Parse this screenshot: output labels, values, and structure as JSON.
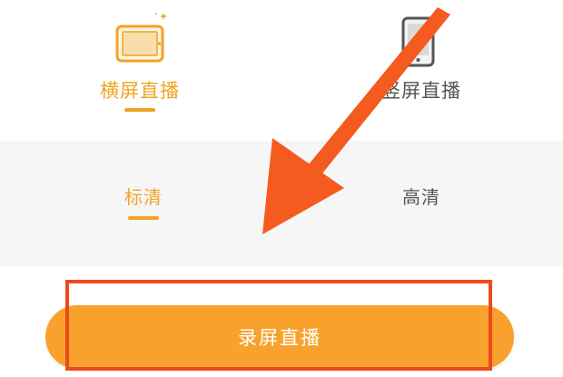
{
  "live_mode": {
    "landscape": {
      "label": "横屏直播",
      "icon": "landscape-phone-icon",
      "selected": true
    },
    "portrait": {
      "label": "竖屏直播",
      "icon": "portrait-phone-icon",
      "selected": false
    }
  },
  "quality": {
    "sd": {
      "label": "标清",
      "selected": true
    },
    "hd": {
      "label": "高清",
      "selected": false
    }
  },
  "start_button": {
    "label": "录屏直播"
  },
  "colors": {
    "accent": "#f0a426",
    "button": "#f8a12c",
    "unselected_text": "#555555",
    "annotation": "#ee4a1d",
    "quality_background": "#f6f6f7"
  }
}
